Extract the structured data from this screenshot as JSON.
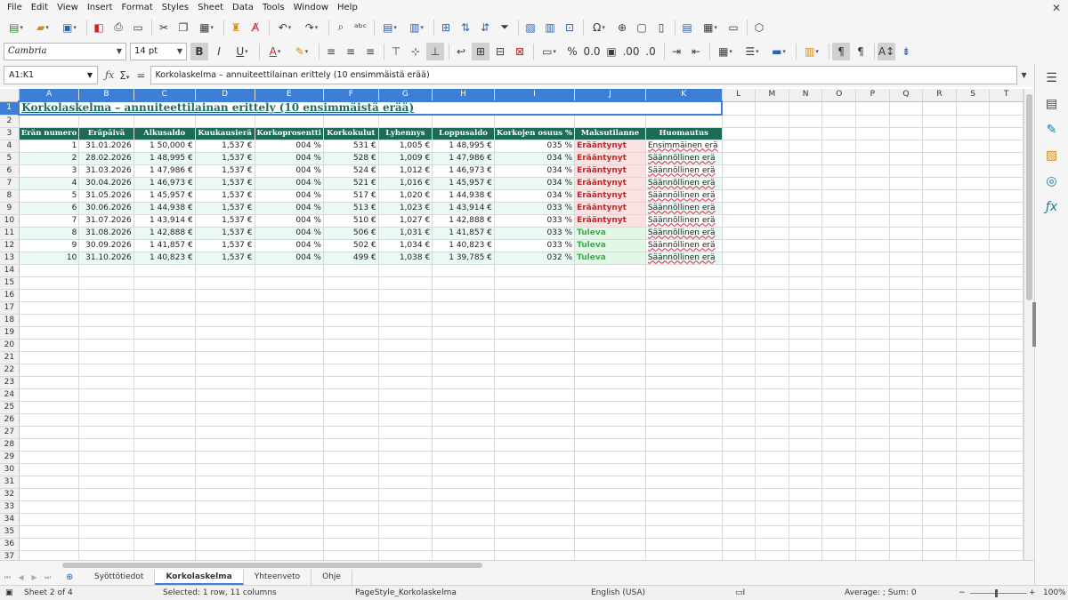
{
  "menu": [
    "File",
    "Edit",
    "View",
    "Insert",
    "Format",
    "Styles",
    "Sheet",
    "Data",
    "Tools",
    "Window",
    "Help"
  ],
  "font": {
    "name": "Cambria",
    "size": "14 pt"
  },
  "namebox": "A1:K1",
  "formula": "Korkolaskelma – annuiteettilainan erittely (10 ensimmäistä erää)",
  "columns": [
    "A",
    "B",
    "C",
    "D",
    "E",
    "F",
    "G",
    "H",
    "I",
    "J",
    "K",
    "L",
    "M",
    "N",
    "O",
    "P",
    "Q",
    "R",
    "S",
    "T"
  ],
  "title": "Korkolaskelma – annuiteettilainan erittely (10 ensimmäistä erää)",
  "headers": [
    "Erän numero",
    "Eräpäivä",
    "Alkusaldo",
    "Kuukausierä",
    "Korkoprosentti",
    "Korkokulut",
    "Lyhennys",
    "Loppusaldo",
    "Korkojen osuus %",
    "Maksutilanne",
    "Huomautus"
  ],
  "rows": [
    [
      "1",
      "31.01.2026",
      "1 50,000 €",
      "1,537 €",
      "004 %",
      "531 €",
      "1,005 €",
      "1 48,995 €",
      "035 %",
      "Erääntynyt",
      "Ensimmäinen erä"
    ],
    [
      "2",
      "28.02.2026",
      "1 48,995 €",
      "1,537 €",
      "004 %",
      "528 €",
      "1,009 €",
      "1 47,986 €",
      "034 %",
      "Erääntynyt",
      "Säännöllinen erä"
    ],
    [
      "3",
      "31.03.2026",
      "1 47,986 €",
      "1,537 €",
      "004 %",
      "524 €",
      "1,012 €",
      "1 46,973 €",
      "034 %",
      "Erääntynyt",
      "Säännöllinen erä"
    ],
    [
      "4",
      "30.04.2026",
      "1 46,973 €",
      "1,537 €",
      "004 %",
      "521 €",
      "1,016 €",
      "1 45,957 €",
      "034 %",
      "Erääntynyt",
      "Säännöllinen erä"
    ],
    [
      "5",
      "31.05.2026",
      "1 45,957 €",
      "1,537 €",
      "004 %",
      "517 €",
      "1,020 €",
      "1 44,938 €",
      "034 %",
      "Erääntynyt",
      "Säännöllinen erä"
    ],
    [
      "6",
      "30.06.2026",
      "1 44,938 €",
      "1,537 €",
      "004 %",
      "513 €",
      "1,023 €",
      "1 43,914 €",
      "033 %",
      "Erääntynyt",
      "Säännöllinen erä"
    ],
    [
      "7",
      "31.07.2026",
      "1 43,914 €",
      "1,537 €",
      "004 %",
      "510 €",
      "1,027 €",
      "1 42,888 €",
      "033 %",
      "Erääntynyt",
      "Säännöllinen erä"
    ],
    [
      "8",
      "31.08.2026",
      "1 42,888 €",
      "1,537 €",
      "004 %",
      "506 €",
      "1,031 €",
      "1 41,857 €",
      "033 %",
      "Tuleva",
      "Säännöllinen erä"
    ],
    [
      "9",
      "30.09.2026",
      "1 41,857 €",
      "1,537 €",
      "004 %",
      "502 €",
      "1,034 €",
      "1 40,823 €",
      "033 %",
      "Tuleva",
      "Säännöllinen erä"
    ],
    [
      "10",
      "31.10.2026",
      "1 40,823 €",
      "1,537 €",
      "004 %",
      "499 €",
      "1,038 €",
      "1 39,785 €",
      "032 %",
      "Tuleva",
      "Säännöllinen erä"
    ]
  ],
  "sheet_tabs": [
    "Syöttötiedot",
    "Korkolaskelma",
    "Yhteenveto",
    "Ohje"
  ],
  "active_tab": "Korkolaskelma",
  "status": {
    "sheet": "Sheet 2 of 4",
    "selection": "Selected: 1 row, 11 columns",
    "page_style": "PageStyle_Korkolaskelma",
    "language": "English (USA)",
    "summary": "Average: ; Sum: 0",
    "zoom": "100%"
  },
  "colors": {
    "header_bg": "#1c6b58",
    "title": "#1e6e5e",
    "overdue": "#d32020",
    "upcoming": "#2fb24a",
    "selection": "#3d7fd6"
  }
}
